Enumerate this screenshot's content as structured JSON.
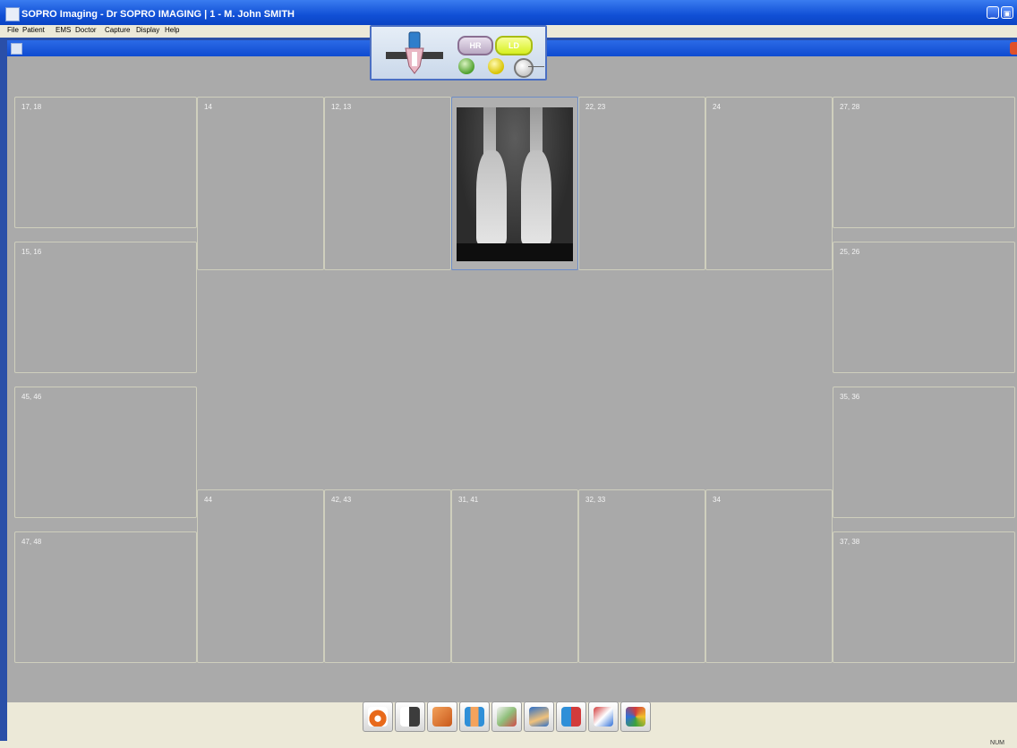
{
  "window": {
    "title": "SOPRO Imaging - Dr SOPRO IMAGING | 1 - M. John SMITH"
  },
  "menu": [
    "File",
    "Patient",
    "EMS",
    "Doctor",
    "Capture",
    "Display",
    "Help"
  ],
  "sensor_panel": {
    "hr_label": "HR",
    "ld_label": "LD",
    "leds": [
      "green",
      "yellow",
      "white"
    ]
  },
  "teeth_slots": [
    {
      "label": "17, 18",
      "filled": false
    },
    {
      "label": "14",
      "filled": false
    },
    {
      "label": "12, 13",
      "filled": false
    },
    {
      "label": "",
      "filled": true
    },
    {
      "label": "22, 23",
      "filled": false
    },
    {
      "label": "24",
      "filled": false
    },
    {
      "label": "27, 28",
      "filled": false
    },
    {
      "label": "15, 16",
      "filled": false
    },
    {
      "label": "25, 26",
      "filled": false
    },
    {
      "label": "45, 46",
      "filled": false
    },
    {
      "label": "35, 36",
      "filled": false
    },
    {
      "label": "44",
      "filled": false
    },
    {
      "label": "42, 43",
      "filled": false
    },
    {
      "label": "31, 41",
      "filled": false
    },
    {
      "label": "32, 33",
      "filled": false
    },
    {
      "label": "34",
      "filled": false
    },
    {
      "label": "47, 48",
      "filled": false
    },
    {
      "label": "37, 38",
      "filled": false
    }
  ],
  "toolbar_icons": [
    "panoramic-icon",
    "tooth-icon",
    "bitewing-icon",
    "occlusal-icon",
    "intraoral-camera-icon",
    "3d-view-icon",
    "compare-icon",
    "export-icon",
    "cube-icon"
  ],
  "status": {
    "num": "NUM"
  },
  "colors": {
    "titlebar": "#1150d6",
    "workspace": "#aaaaaa",
    "slot_border": "#cfcfbd",
    "accent_led_green": "#4fa02c",
    "accent_led_yellow": "#d8c300"
  }
}
